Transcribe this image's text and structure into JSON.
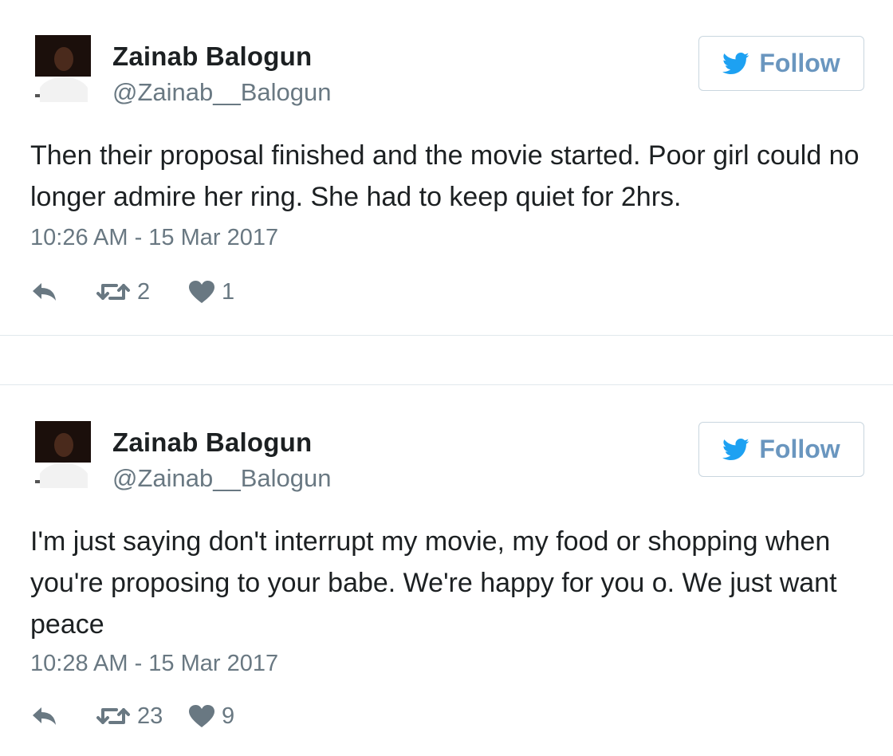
{
  "tweets": [
    {
      "name": "Zainab Balogun",
      "handle": "@Zainab__Balogun",
      "follow_label": "Follow",
      "text": "Then their proposal finished and the movie started. Poor girl could no longer admire her ring. She had to keep quiet for 2hrs.",
      "timestamp": "10:26 AM - 15 Mar 2017",
      "retweets": "2",
      "likes": "1"
    },
    {
      "name": "Zainab Balogun",
      "handle": "@Zainab__Balogun",
      "follow_label": "Follow",
      "text": "I'm just saying don't interrupt my movie, my food or shopping when you're proposing to your babe. We're happy for you o. We just want peace",
      "timestamp": "10:28 AM - 15 Mar 2017",
      "retweets": "23",
      "likes": "9"
    }
  ],
  "colors": {
    "accent": "#1da1f2",
    "follow_text": "#6a96bf",
    "secondary_text": "#697882",
    "border": "#e1e8ed"
  },
  "icons": [
    "avatar",
    "twitter-bird-icon",
    "reply-icon",
    "retweet-icon",
    "heart-icon"
  ]
}
